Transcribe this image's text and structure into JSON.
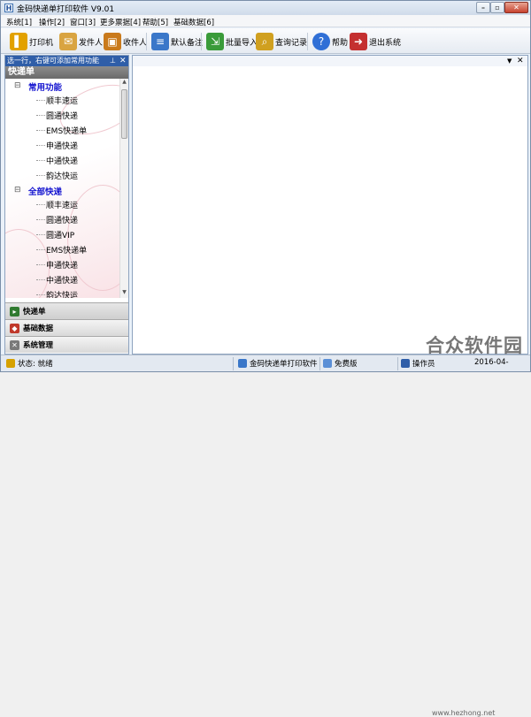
{
  "window": {
    "title": "金码快递单打印软件 V9.01",
    "app_icon": "H"
  },
  "menu": [
    "系统[1]",
    "操作[2]",
    "窗口[3]",
    "更多票据[4]",
    "帮助[5]",
    "基础数据[6]"
  ],
  "toolbar": [
    {
      "label": "打印机",
      "icon": "printer-icon",
      "color": "#e2a100"
    },
    {
      "label": "发件人",
      "icon": "envelope-icon",
      "color": "#d9a441"
    },
    {
      "label": "收件人",
      "icon": "mailbox-icon",
      "color": "#c97a1c"
    },
    {
      "label": "默认备注",
      "icon": "note-icon",
      "color": "#3a77c9"
    },
    {
      "label": "批量导入",
      "icon": "import-icon",
      "color": "#3a9b3a"
    },
    {
      "label": "查询记录",
      "icon": "magnifier-icon",
      "color": "#d0a020"
    },
    {
      "label": "帮助",
      "icon": "help-icon",
      "color": "#2f6fd6"
    },
    {
      "label": "退出系统",
      "icon": "exit-icon",
      "color": "#c43030"
    }
  ],
  "left_panel": {
    "hint": "选一行，右键可添加常用功能",
    "title": "快递单",
    "tree": [
      {
        "category": "常用功能",
        "items": [
          "顺丰速运",
          "圆通快递",
          "EMS快递单",
          "申通快递",
          "中通快递",
          "韵达快运"
        ]
      },
      {
        "category": "全部快递",
        "items": [
          "顺丰速运",
          "圆通快递",
          "圆通VIP",
          "EMS快递单",
          "申通快递",
          "中通快递",
          "韵达快运"
        ]
      }
    ],
    "nav": [
      {
        "label": "快递单",
        "icon": "express-icon",
        "color": "#2f7a2f"
      },
      {
        "label": "基础数据",
        "icon": "data-icon",
        "color": "#c0392b"
      },
      {
        "label": "系统管理",
        "icon": "tools-icon",
        "color": "#7a7a7a"
      }
    ]
  },
  "status": {
    "state": "状态: 就绪",
    "app": "金码快递单打印软件",
    "license": "免费版",
    "operator": "操作员",
    "date": "2016-04-"
  },
  "watermark": {
    "text": "合众软件园",
    "url": "www.hezhong.net"
  },
  "colors": {
    "hint_bg": "#2f5ea8",
    "category": "#1515d0"
  }
}
